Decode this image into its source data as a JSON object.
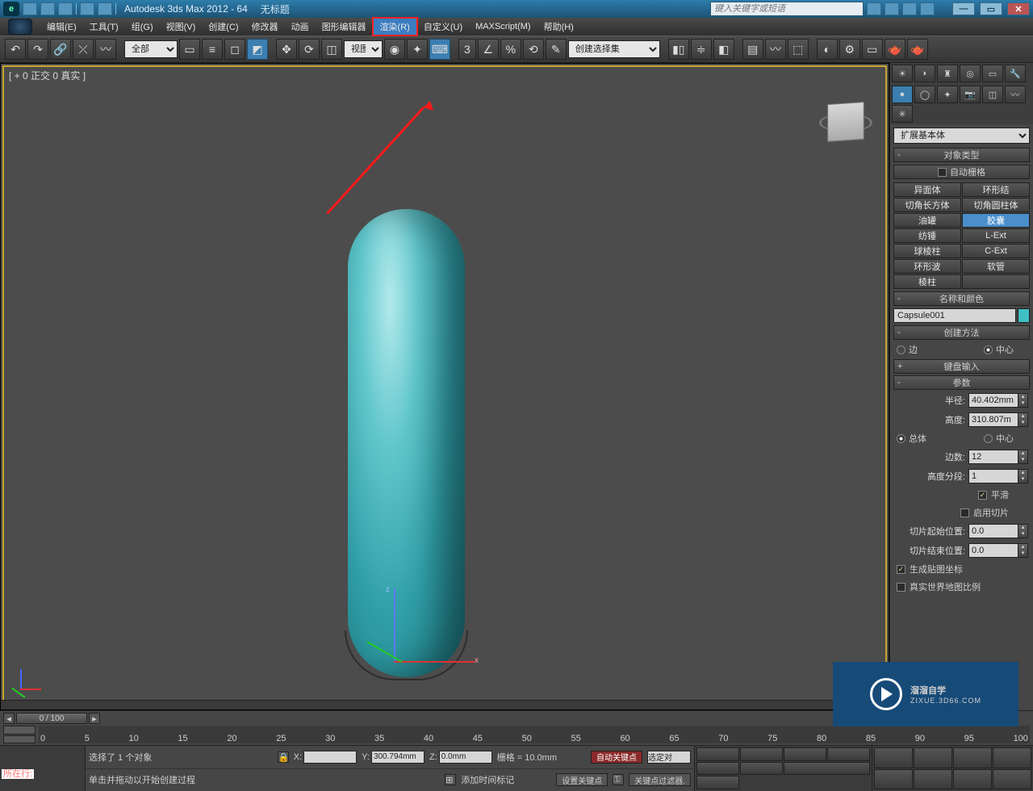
{
  "title": {
    "app": "Autodesk 3ds Max 2012 - 64",
    "doc": "无标题"
  },
  "search_placeholder": "键入关键字或短语",
  "menu": [
    "编辑(E)",
    "工具(T)",
    "组(G)",
    "视图(V)",
    "创建(C)",
    "修改器",
    "动画",
    "图形编辑器",
    "渲染(R)",
    "自定义(U)",
    "MAXScript(M)",
    "帮助(H)"
  ],
  "menu_hl_index": 8,
  "toolbar": {
    "filter": "全部",
    "view": "视图",
    "named": "创建选择集"
  },
  "viewport_label": "[ + 0 正交 0 真实 ]",
  "cmd": {
    "category": "扩展基本体",
    "objtype_head": "对象类型",
    "autogrid": "自动栅格",
    "buttons": [
      [
        "异面体",
        "环形结"
      ],
      [
        "切角长方体",
        "切角圆柱体"
      ],
      [
        "油罐",
        "胶囊"
      ],
      [
        "纺锤",
        "L-Ext"
      ],
      [
        "球棱柱",
        "C-Ext"
      ],
      [
        "环形波",
        "软管"
      ],
      [
        "棱柱",
        ""
      ]
    ],
    "active_btn": "胶囊",
    "name_head": "名称和颜色",
    "obj_name": "Capsule001",
    "method_head": "创建方法",
    "method": {
      "a": "边",
      "b": "中心",
      "sel": "b"
    },
    "kbd_head": "键盘输入",
    "params_head": "参数",
    "radius_l": "半径:",
    "radius_v": "40.402mm",
    "height_l": "高度:",
    "height_v": "310.807m",
    "overall": {
      "a": "总体",
      "b": "中心",
      "sel": "a"
    },
    "sides_l": "边数:",
    "sides_v": "12",
    "hseg_l": "高度分段:",
    "hseg_v": "1",
    "smooth": "平滑",
    "slice_on": "启用切片",
    "slice_from_l": "切片起始位置:",
    "slice_from_v": "0.0",
    "slice_to_l": "切片结束位置:",
    "slice_to_v": "0.0",
    "genmap": "生成贴图坐标",
    "realworld": "真实世界地图比例"
  },
  "time": {
    "range": "0 / 100",
    "ticks": [
      "0",
      "5",
      "10",
      "15",
      "20",
      "25",
      "30",
      "35",
      "40",
      "45",
      "50",
      "55",
      "60",
      "65",
      "70",
      "75",
      "80",
      "85",
      "90",
      "95",
      "100"
    ]
  },
  "status": {
    "line_label": "所在行:",
    "sel": "选择了 1 个对象",
    "prompt": "单击并拖动以开始创建过程",
    "x": "",
    "y": "300.794mm",
    "z": "0.0mm",
    "grid": "栅格 = 10.0mm",
    "autokey": "自动关键点",
    "setkey": "设置关键点",
    "selfilter": "选定对",
    "keyfilter": "关键点过滤器.",
    "addtime": "添加时间标记"
  },
  "watermark": {
    "big": "溜溜自学",
    "small": "ZIXUE.3D66.COM"
  }
}
